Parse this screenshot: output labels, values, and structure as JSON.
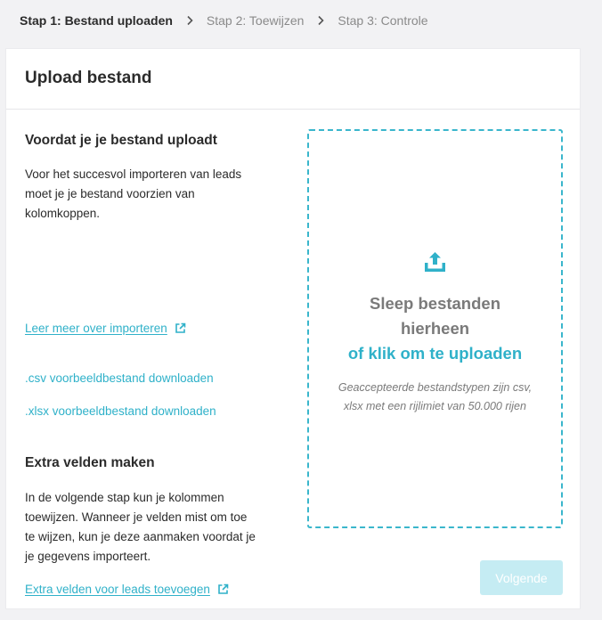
{
  "stepper": {
    "steps": [
      {
        "label": "Stap 1: Bestand uploaden",
        "active": true
      },
      {
        "label": "Stap 2: Toewijzen",
        "active": false
      },
      {
        "label": "Stap 3: Controle",
        "active": false
      }
    ]
  },
  "card": {
    "title": "Upload bestand",
    "before_upload": {
      "heading": "Voordat je je bestand uploadt",
      "lines": [
        "Voor het succesvol importeren van leads",
        "moet je je bestand voorzien van",
        "kolomkoppen."
      ],
      "learn_more_link": "Leer meer over importeren",
      "csv_link": ".csv voorbeeldbestand downloaden",
      "xlsx_link": ".xlsx voorbeeldbestand downloaden"
    },
    "extra_fields": {
      "heading": "Extra velden maken",
      "lines": [
        "In de volgende stap kun je kolommen",
        "toewijzen. Wanneer je velden mist om toe",
        "te wijzen, kun je deze aanmaken voordat je",
        "je gegevens importeert."
      ],
      "add_fields_link": "Extra velden voor leads toevoegen"
    },
    "dropzone": {
      "icon": "upload-icon",
      "main_line1": "Sleep bestanden",
      "main_line2": "hierheen",
      "click_text": "of klik om te uploaden",
      "note_line1": "Geaccepteerde bestandstypen zijn csv,",
      "note_line2": "xlsx met een rijlimiet van 50.000 rijen"
    },
    "next_button": "Volgende"
  },
  "colors": {
    "accent": "#2fb1c9",
    "button_disabled": "#c5ecf3",
    "background": "#f2f2f4"
  }
}
